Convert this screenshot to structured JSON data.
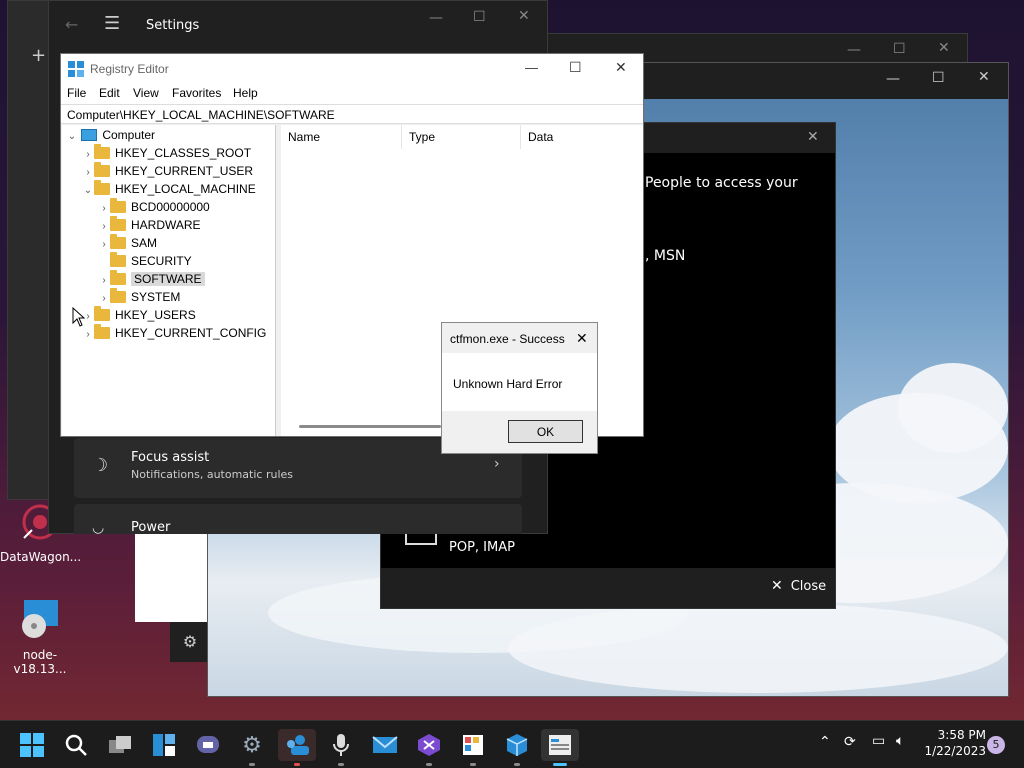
{
  "desktop": {
    "icons": [
      {
        "label": "DataWagon..."
      },
      {
        "label": "node-v18.13..."
      }
    ]
  },
  "settings": {
    "title": "Settings",
    "focus_assist": {
      "title": "Focus assist",
      "subtitle": "Notifications, automatic rules"
    },
    "power": {
      "title": "Power"
    }
  },
  "mail_dialog": {
    "text_line1": "People to access your",
    "text_line2": ", MSN",
    "pop_imap": "POP, IMAP",
    "close_label": "Close"
  },
  "regedit": {
    "title": "Registry Editor",
    "menu": [
      "File",
      "Edit",
      "View",
      "Favorites",
      "Help"
    ],
    "address": "Computer\\HKEY_LOCAL_MACHINE\\SOFTWARE",
    "columns": [
      "Name",
      "Type",
      "Data"
    ],
    "tree": [
      {
        "label": "Computer",
        "level": 0,
        "expanded": true
      },
      {
        "label": "HKEY_CLASSES_ROOT",
        "level": 1
      },
      {
        "label": "HKEY_CURRENT_USER",
        "level": 1
      },
      {
        "label": "HKEY_LOCAL_MACHINE",
        "level": 1,
        "expanded": true
      },
      {
        "label": "BCD00000000",
        "level": 2
      },
      {
        "label": "HARDWARE",
        "level": 2
      },
      {
        "label": "SAM",
        "level": 2
      },
      {
        "label": "SECURITY",
        "level": 2
      },
      {
        "label": "SOFTWARE",
        "level": 2,
        "selected": true
      },
      {
        "label": "SYSTEM",
        "level": 2
      },
      {
        "label": "HKEY_USERS",
        "level": 1
      },
      {
        "label": "HKEY_CURRENT_CONFIG",
        "level": 1
      }
    ]
  },
  "error_dialog": {
    "title": "ctfmon.exe - Success",
    "message": "Unknown Hard Error",
    "ok_label": "OK"
  },
  "taskbar": {
    "time": "3:58 PM",
    "date": "1/22/2023",
    "notification_count": "5",
    "apps": [
      "start-icon",
      "search-icon",
      "task-view-icon",
      "widgets-icon",
      "teams-icon",
      "settings-icon",
      "people-icon",
      "microphone-icon",
      "mail-icon",
      "visual-studio-icon",
      "photo-app-icon",
      "package-icon",
      "registry-editor-icon"
    ]
  },
  "colors": {
    "accent": "#0078d4",
    "folder": "#e8b73c",
    "taskbar": "#1c1c1c"
  }
}
